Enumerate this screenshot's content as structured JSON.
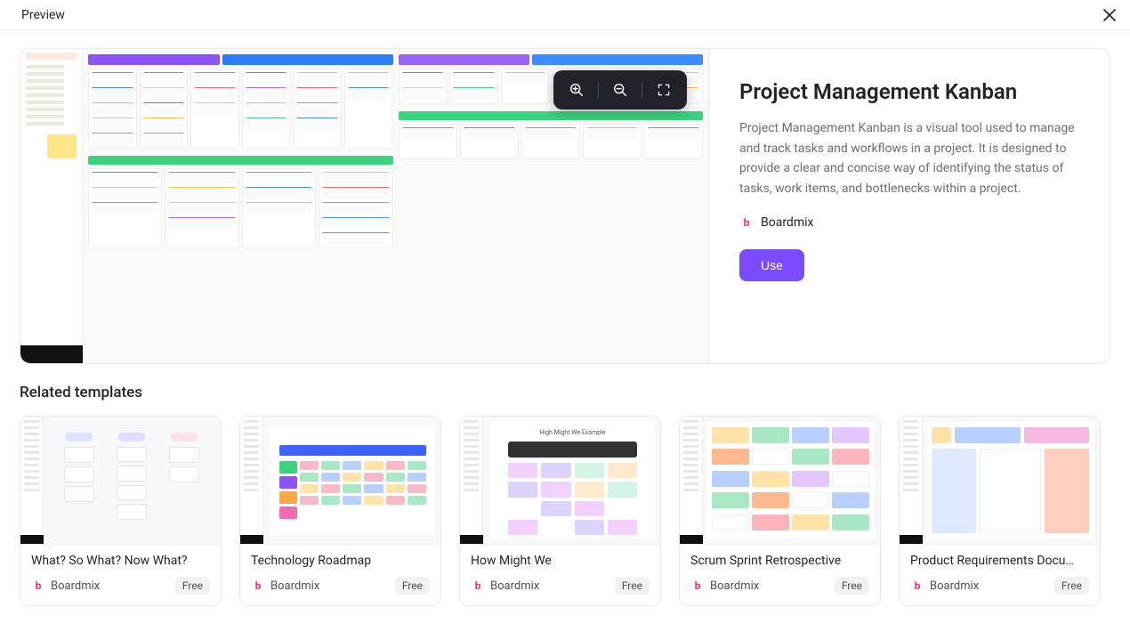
{
  "header": {
    "title": "Preview"
  },
  "details": {
    "title": "Project Management Kanban",
    "description": "Project Management Kanban is a visual tool used to manage and track tasks and workflows in a project. It is designed to provide a clear and concise way of identifying the status of tasks, work items, and bottlenecks within a project.",
    "brand": "Boardmix",
    "use_label": "Use"
  },
  "related": {
    "heading": "Related templates",
    "cards": [
      {
        "title": "What? So What? Now What?",
        "brand": "Boardmix",
        "badge": "Free"
      },
      {
        "title": "Technology Roadmap",
        "brand": "Boardmix",
        "badge": "Free"
      },
      {
        "title": "How Might We",
        "brand": "Boardmix",
        "badge": "Free"
      },
      {
        "title": "Scrum Sprint Retrospective",
        "brand": "Boardmix",
        "badge": "Free"
      },
      {
        "title": "Product Requirements Docu…",
        "brand": "Boardmix",
        "badge": "Free"
      }
    ]
  },
  "toolbar": {
    "zoom_in": "zoom-in-icon",
    "zoom_out": "zoom-out-icon",
    "fullscreen": "fullscreen-icon"
  }
}
